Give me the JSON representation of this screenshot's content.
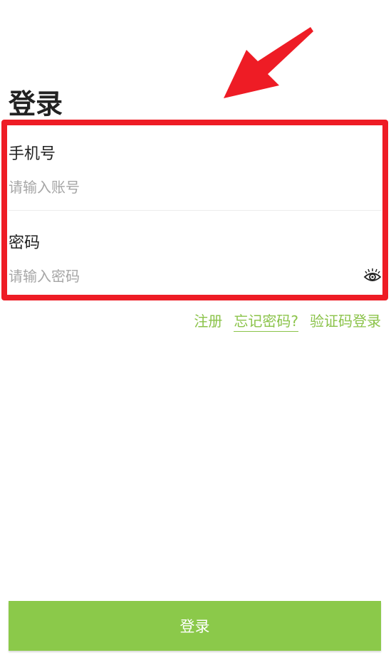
{
  "page": {
    "title": "登录"
  },
  "form": {
    "phone": {
      "label": "手机号",
      "placeholder": "请输入账号",
      "value": ""
    },
    "password": {
      "label": "密码",
      "placeholder": "请输入密码",
      "value": "",
      "toggle_icon": "eye-icon"
    }
  },
  "links": {
    "register": "注册",
    "forgot_password": "忘记密码?",
    "sms_login": "验证码登录"
  },
  "actions": {
    "login_label": "登录"
  },
  "colors": {
    "accent": "#8bc34a",
    "button": "#8bc94a",
    "annotation": "#ee1c25"
  }
}
